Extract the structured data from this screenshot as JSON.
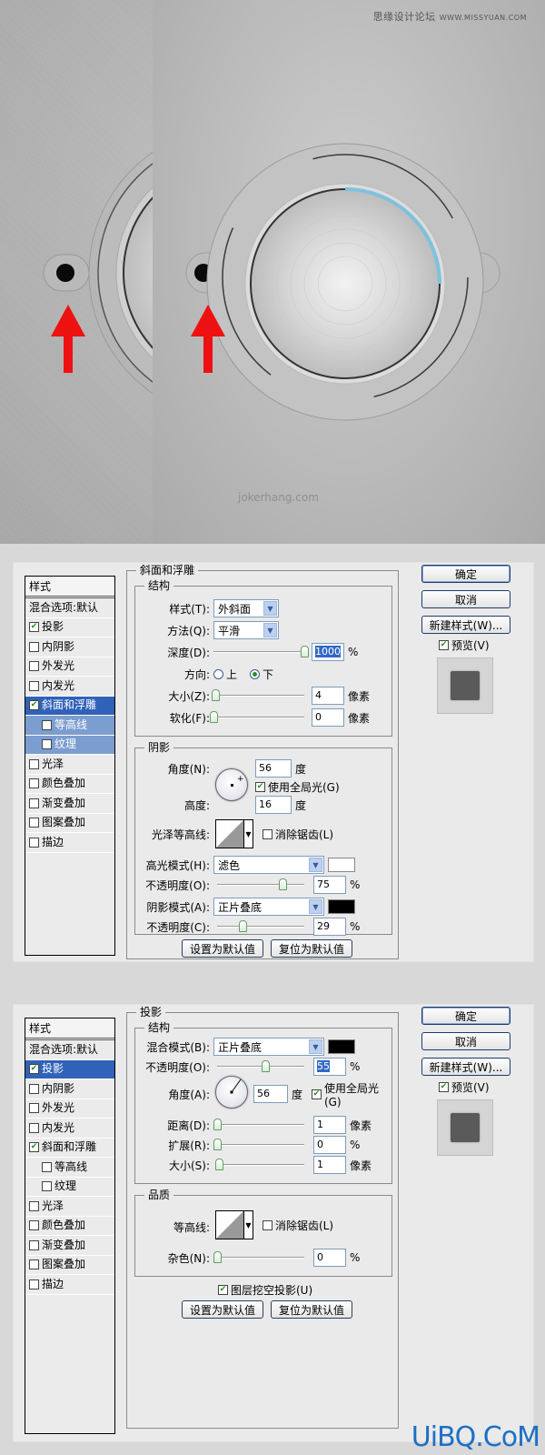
{
  "hero": {
    "watermark_site": "思缘设计论坛",
    "watermark_url": "WWW.MISSYUAN.COM",
    "credit": "jokerhang.com",
    "accent_arc_color": "#7fc1dc",
    "arrow_color": "#ee1111"
  },
  "dialog_bevel": {
    "style_list": {
      "header": "样式",
      "blend_options": "混合选项:默认",
      "items": [
        {
          "label": "投影",
          "checked": true,
          "state": "normal"
        },
        {
          "label": "内阴影",
          "checked": false,
          "state": "normal"
        },
        {
          "label": "外发光",
          "checked": false,
          "state": "normal"
        },
        {
          "label": "内发光",
          "checked": false,
          "state": "normal"
        },
        {
          "label": "斜面和浮雕",
          "checked": true,
          "state": "selected"
        },
        {
          "label": "等高线",
          "checked": false,
          "state": "subselected"
        },
        {
          "label": "纹理",
          "checked": false,
          "state": "subselected"
        },
        {
          "label": "光泽",
          "checked": false,
          "state": "normal"
        },
        {
          "label": "颜色叠加",
          "checked": false,
          "state": "normal"
        },
        {
          "label": "渐变叠加",
          "checked": false,
          "state": "normal"
        },
        {
          "label": "图案叠加",
          "checked": false,
          "state": "normal"
        },
        {
          "label": "描边",
          "checked": false,
          "state": "normal"
        }
      ]
    },
    "title": "斜面和浮雕",
    "structure": {
      "title": "结构",
      "style_label": "样式(T):",
      "style_value": "外斜面",
      "technique_label": "方法(Q):",
      "technique_value": "平滑",
      "depth_label": "深度(D):",
      "depth_value": "1000",
      "depth_unit": "%",
      "depth_slider": 1.0,
      "direction_label": "方向:",
      "direction_up": "上",
      "direction_down": "下",
      "direction_selected": "下",
      "size_label": "大小(Z):",
      "size_value": "4",
      "size_unit": "像素",
      "size_slider": 0.02,
      "soften_label": "软化(F):",
      "soften_value": "0",
      "soften_unit": "像素",
      "soften_slider": 0.0
    },
    "shading": {
      "title": "阴影",
      "angle_label": "角度(N):",
      "angle_value": "56",
      "angle_unit": "度",
      "global_light_label": "使用全局光(G)",
      "global_light_checked": true,
      "altitude_label": "高度:",
      "altitude_value": "16",
      "altitude_unit": "度",
      "gloss_contour_label": "光泽等高线:",
      "anti_alias_label": "消除锯齿(L)",
      "anti_alias_checked": false,
      "highlight_mode_label": "高光模式(H):",
      "highlight_mode_value": "滤色",
      "highlight_color": "#ffffff",
      "highlight_opacity_label": "不透明度(O):",
      "highlight_opacity_value": "75",
      "highlight_opacity_unit": "%",
      "highlight_opacity_slider": 0.75,
      "shadow_mode_label": "阴影模式(A):",
      "shadow_mode_value": "正片叠底",
      "shadow_color": "#000000",
      "shadow_opacity_label": "不透明度(C):",
      "shadow_opacity_value": "29",
      "shadow_opacity_unit": "%",
      "shadow_opacity_slider": 0.29
    },
    "make_default": "设置为默认值",
    "reset_default": "复位为默认值",
    "ok": "确定",
    "cancel": "取消",
    "new_style": "新建样式(W)...",
    "preview_label": "预览(V)",
    "preview_checked": true
  },
  "dialog_shadow": {
    "style_list": {
      "header": "样式",
      "blend_options": "混合选项:默认",
      "items": [
        {
          "label": "投影",
          "checked": true,
          "state": "selected"
        },
        {
          "label": "内阴影",
          "checked": false,
          "state": "normal"
        },
        {
          "label": "外发光",
          "checked": false,
          "state": "normal"
        },
        {
          "label": "内发光",
          "checked": false,
          "state": "normal"
        },
        {
          "label": "斜面和浮雕",
          "checked": true,
          "state": "normal"
        },
        {
          "label": "等高线",
          "checked": false,
          "state": "sub"
        },
        {
          "label": "纹理",
          "checked": false,
          "state": "sub"
        },
        {
          "label": "光泽",
          "checked": false,
          "state": "normal"
        },
        {
          "label": "颜色叠加",
          "checked": false,
          "state": "normal"
        },
        {
          "label": "渐变叠加",
          "checked": false,
          "state": "normal"
        },
        {
          "label": "图案叠加",
          "checked": false,
          "state": "normal"
        },
        {
          "label": "描边",
          "checked": false,
          "state": "normal"
        }
      ]
    },
    "title": "投影",
    "structure": {
      "title": "结构",
      "blend_mode_label": "混合模式(B):",
      "blend_mode_value": "正片叠底",
      "blend_color": "#000000",
      "opacity_label": "不透明度(O):",
      "opacity_value": "55",
      "opacity_unit": "%",
      "opacity_slider": 0.55,
      "angle_label": "角度(A):",
      "angle_value": "56",
      "angle_unit": "度",
      "global_light_label": "使用全局光(G)",
      "global_light_checked": true,
      "distance_label": "距离(D):",
      "distance_value": "1",
      "distance_unit": "像素",
      "distance_slider": 0.0,
      "spread_label": "扩展(R):",
      "spread_value": "0",
      "spread_unit": "%",
      "spread_slider": 0.0,
      "size_label": "大小(S):",
      "size_value": "1",
      "size_unit": "像素",
      "size_slider": 0.02
    },
    "quality": {
      "title": "品质",
      "contour_label": "等高线:",
      "anti_alias_label": "消除锯齿(L)",
      "anti_alias_checked": false,
      "noise_label": "杂色(N):",
      "noise_value": "0",
      "noise_unit": "%",
      "noise_slider": 0.0
    },
    "knockout_label": "图层挖空投影(U)",
    "knockout_checked": true,
    "make_default": "设置为默认值",
    "reset_default": "复位为默认值",
    "ok": "确定",
    "cancel": "取消",
    "new_style": "新建样式(W)...",
    "preview_label": "预览(V)",
    "preview_checked": true
  },
  "site_watermark": "UiBQ.CoM"
}
